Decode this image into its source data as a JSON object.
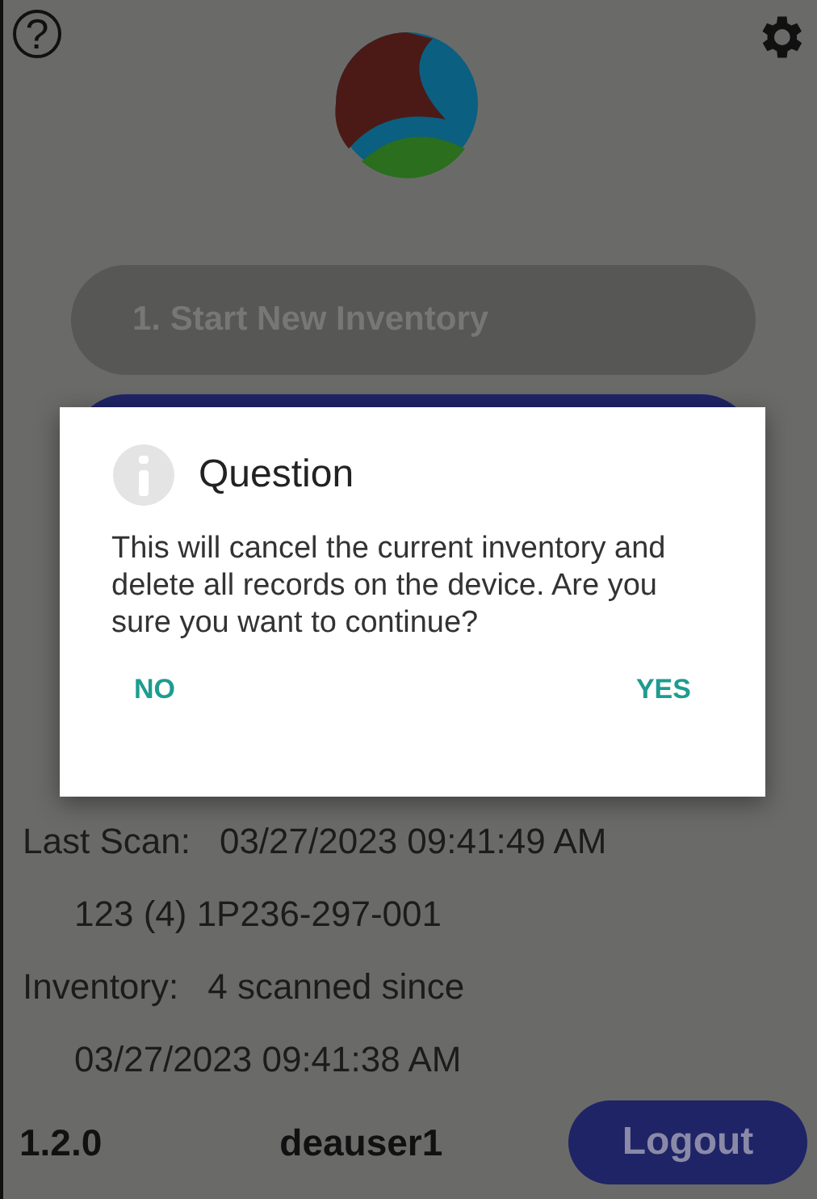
{
  "header": {
    "help": "?"
  },
  "menu_buttons": [
    {
      "label": "1. Start New Inventory",
      "disabled": true
    }
  ],
  "dialog": {
    "title": "Question",
    "message": "This will cancel the current inventory and delete all records on the device. Are you sure you want to continue?",
    "buttons": [
      "NO",
      "YES"
    ]
  },
  "status": [
    {
      "label": "Last Scan:",
      "value": "03/27/2023 09:41:49 AM"
    },
    {
      "value": "123 (4)  1P236-297-001"
    },
    {
      "label": "Inventory:",
      "value": "4 scanned since"
    },
    {
      "value": "03/27/2023 09:41:38 AM"
    }
  ],
  "footer": {
    "version": "1.2.0",
    "user": "deauser1",
    "logout": "Logout"
  }
}
